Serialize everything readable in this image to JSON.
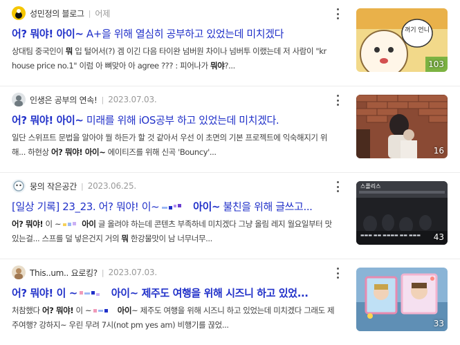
{
  "results": [
    {
      "blog_name": "성민정의 블로그",
      "date": "어제",
      "title_a": "어? 뭐야! 아이~",
      "title_b": " A+을 위해 열심히 공부하고 있었는데 미치겠다",
      "snippet_parts": [
        "상대팀 중국인이 ",
        "뭐",
        " 입 털어서(?) 겜 이긴 다음 타이완 넘버원 차이나 넘버투 이랬는데 저 사람이 \"kr house price no.1\" 이럼 아 뼈맞아 아 agree ??? : 피어나가 ",
        "뭐야",
        "?..."
      ],
      "thumb_count": "103",
      "thumb_bubble": "꺼기 언니"
    },
    {
      "blog_name": "인생은 공부의 연속!",
      "date": "2023.07.03.",
      "title_a": "어? 뭐야! 아이~",
      "title_b": " 미래를 위해 iOS공부 하고 있었는데 미치겠다.",
      "snippet_parts": [
        "일단 스위프트 문법을 알아야 뭘 하든가 할 것 같아서 우선 이 초면의 기본 프로젝트에 익숙해지기 위해... 하현상 ",
        "어? 뭐야! 아이~",
        " 에이티즈를 위해 신곡 'Bouncy'..."
      ],
      "thumb_count": "16"
    },
    {
      "blog_name": "뭉의 작은공간",
      "date": "2023.06.25.",
      "title_a": "[일상 기록] 23_23. 어? 뭐야! 이~",
      "title_b": " 아이~",
      "title_c": " 불친을 위해 글쓰고...",
      "snippet_parts": [
        "어? 뭐야!",
        " 이 ~",
        "아이",
        " 글 올려야 하는데 콘텐츠 부족하네 미치겠다 그냥 올림 레지 월요일부터 맛있는걸... 스프를 덜 넣은건지 거의 ",
        "뭐",
        " 한강물맛이 남 너무너무..."
      ],
      "thumb_count": "43",
      "thumb_caption": "스플리스"
    },
    {
      "blog_name": "This..um.. 요로킹?",
      "date": "2023.07.03.",
      "title_a": "어? 뭐야! 이 ~",
      "title_b": " 아이~ 제주도 여행을 위해 시즈니 하고 있었...",
      "snippet_parts": [
        "처참했다 ",
        "어? 뭐야!",
        " 이 ~",
        " 아이",
        "~ 제주도 여행을 위해 시즈니 하고 있었는데 미치겠다 그래도 제주여행? 강하지~ 우린 무려 7시(not pm yes am) 비행기를 끊었..."
      ],
      "thumb_count": "33"
    }
  ],
  "colors": {
    "title": "#2131c9",
    "meta": "#999999",
    "snippet": "#404040"
  }
}
